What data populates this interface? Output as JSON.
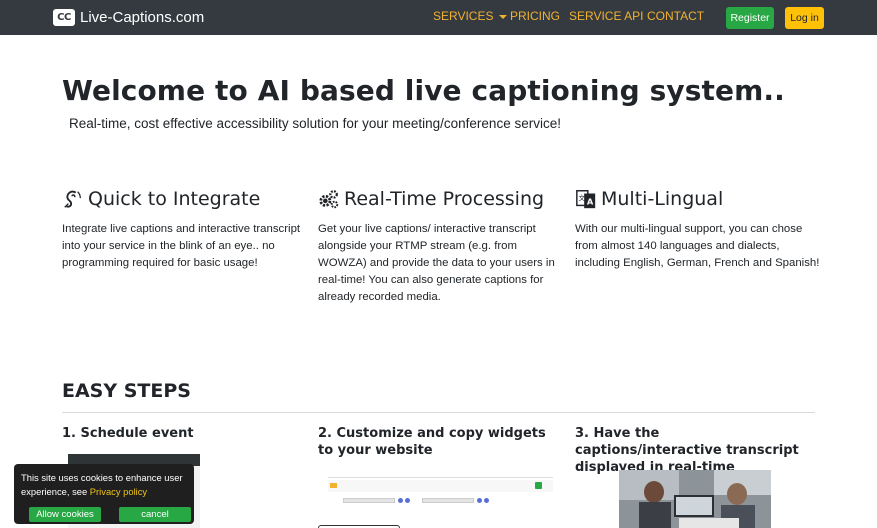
{
  "navbar": {
    "brand_logo": "CC",
    "brand_name": "Live-Captions.com",
    "links": [
      "SERVICES",
      "PRICING",
      "SERVICE API",
      "CONTACT"
    ],
    "register_label": "Register",
    "login_label": "Log in",
    "colors": {
      "background": "#343a40",
      "link": "#f0b230",
      "register": "#28a745",
      "login": "#ffc107"
    }
  },
  "hero": {
    "title": "Welcome to AI based live captioning system..",
    "subtitle": "Real-time, cost effective accessibility solution for your meeting/conference service!"
  },
  "features": [
    {
      "icon": "hearing-icon",
      "title": "Quick to Integrate",
      "text": "Integrate live captions and interactive transcript into your service in the blink of an eye.. no programming required for basic usage!"
    },
    {
      "icon": "gears-icon",
      "title": "Real-Time Processing",
      "text": "Get your live captions/ interactive transcript alongside your RTMP stream (e.g. from WOWZA) and provide the data to your users in real-time! You can also generate captions for already recorded media."
    },
    {
      "icon": "language-icon",
      "title": "Multi-Lingual",
      "text": "With our multi-lingual support, you can chose from almost 140 languages and dialects, including English, German, French and Spanish!"
    }
  ],
  "easy_steps": {
    "heading": "EASY STEPS",
    "steps": [
      "1. Schedule event",
      "2. Customize and copy widgets to your website",
      "3. Have the captions/interactive transcript displayed in real-time"
    ]
  },
  "cookie_banner": {
    "text": "This site uses cookies to enhance user experience, see ",
    "link": "Privacy policy",
    "allow_label": "Allow cookies",
    "cancel_label": "cancel"
  }
}
